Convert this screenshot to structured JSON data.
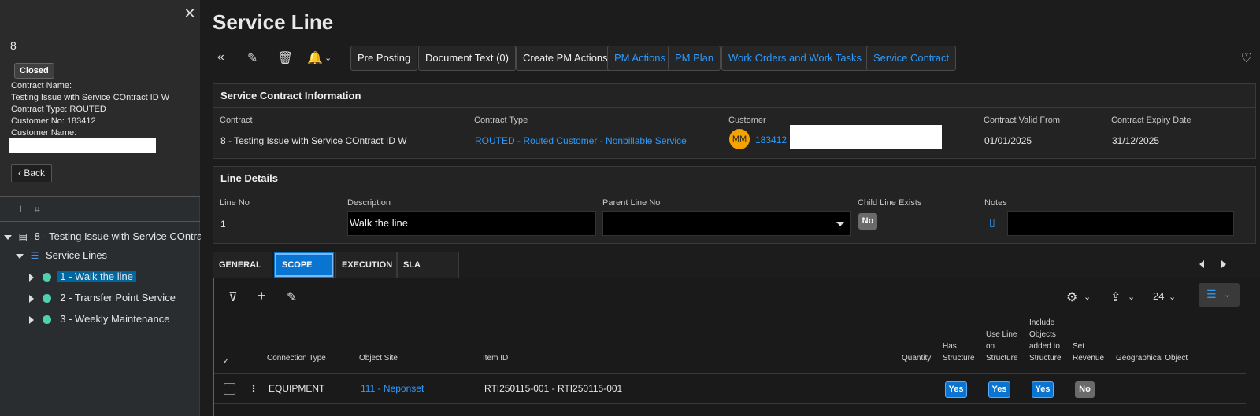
{
  "left_panel": {
    "record_id": "8",
    "status_badge": "Closed",
    "contract_name_label": "Contract Name:",
    "contract_name_value": "Testing Issue with Service COntract ID W",
    "contract_type_line": "Contract Type:   ROUTED",
    "customer_no_line": "Customer No:   183412",
    "customer_name_label": "Customer Name:",
    "back_label": "Back",
    "tree": {
      "root": "8 - Testing Issue with Service COntra",
      "group": "Service Lines",
      "items": [
        "1 - Walk the line",
        "2 - Transfer Point Service",
        "3 - Weekly Maintenance"
      ]
    }
  },
  "header": {
    "title": "Service Line",
    "buttons": {
      "pre_posting": "Pre Posting",
      "document_text": "Document Text (0)",
      "create_pm_actions": "Create PM Actions",
      "pm_actions": "PM Actions",
      "pm_plan": "PM Plan",
      "work_orders": "Work Orders and Work Tasks",
      "service_contract": "Service Contract"
    }
  },
  "contract_info": {
    "title": "Service Contract Information",
    "contract_label": "Contract",
    "contract_value": "8 - Testing Issue with Service COntract ID W",
    "type_label": "Contract Type",
    "type_value": "ROUTED - Routed Customer - Nonbillable Service",
    "customer_label": "Customer",
    "customer_initials": "MM",
    "customer_value": "183412 -",
    "valid_from_label": "Contract Valid From",
    "valid_from_value": "01/01/2025",
    "expiry_label": "Contract Expiry Date",
    "expiry_value": "31/12/2025"
  },
  "line_details": {
    "title": "Line Details",
    "line_no_label": "Line No",
    "line_no_value": "1",
    "description_label": "Description",
    "description_value": "Walk the line",
    "parent_label": "Parent Line No",
    "child_label": "Child Line Exists",
    "child_value": "No",
    "notes_label": "Notes"
  },
  "tabs": [
    "GENERAL",
    "SCOPE",
    "EXECUTION",
    "SLA"
  ],
  "grid": {
    "page_size": "24",
    "headers": {
      "connection_type": "Connection Type",
      "object_site": "Object Site",
      "item_id": "Item ID",
      "quantity": "Quantity",
      "has_structure": "Has Structure",
      "use_line": "Use Line on Structure",
      "include_objects": "Include Objects added to Structure",
      "set_revenue": "Set Revenue",
      "geo_object": "Geographical Object"
    },
    "row": {
      "connection_type": "EQUIPMENT",
      "object_site": "111 - Neponset",
      "item_id": "RTI250115-001 - RTI250115-001",
      "has_structure": "Yes",
      "use_line": "Yes",
      "include_objects": "Yes",
      "set_revenue": "No"
    }
  },
  "colors": {
    "accent": "#0a74d1",
    "link": "#2b9bff",
    "tree_dot": "#4fd1b0",
    "avatar": "#f5a300"
  }
}
